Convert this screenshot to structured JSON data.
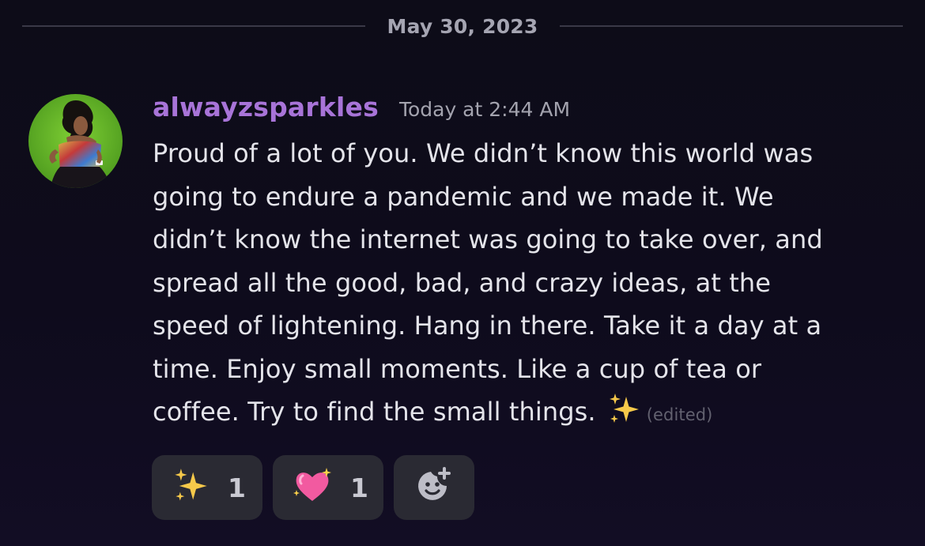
{
  "date_divider": "May 30, 2023",
  "message": {
    "author": "alwayzsparkles",
    "timestamp": "Today at 2:44 AM",
    "lines": [
      "Proud of a lot of you.  We didn’t know this world was",
      "going to endure a pandemic and we made it. We",
      "didn’t know the internet was going to take over, and",
      "spread all the good, bad, and crazy ideas, at the",
      "speed of lightening.  Hang in there. Take it a day at a",
      "time. Enjoy small moments. Like a cup of tea or",
      "coffee. Try to find the small things."
    ],
    "edited_label": "(edited)",
    "inline_emoji": "sparkles-emoji"
  },
  "reactions": [
    {
      "emoji": "sparkles-emoji",
      "count": "1"
    },
    {
      "emoji": "sparkling-heart-emoji",
      "count": "1"
    }
  ],
  "add_reaction_icon": "add-reaction-icon",
  "colors": {
    "background": "#0d0b1a",
    "author": "#a874d8",
    "reaction_bg": "#2a2a33",
    "sparkle": "#f6c94a",
    "heart": "#f25aa0"
  }
}
